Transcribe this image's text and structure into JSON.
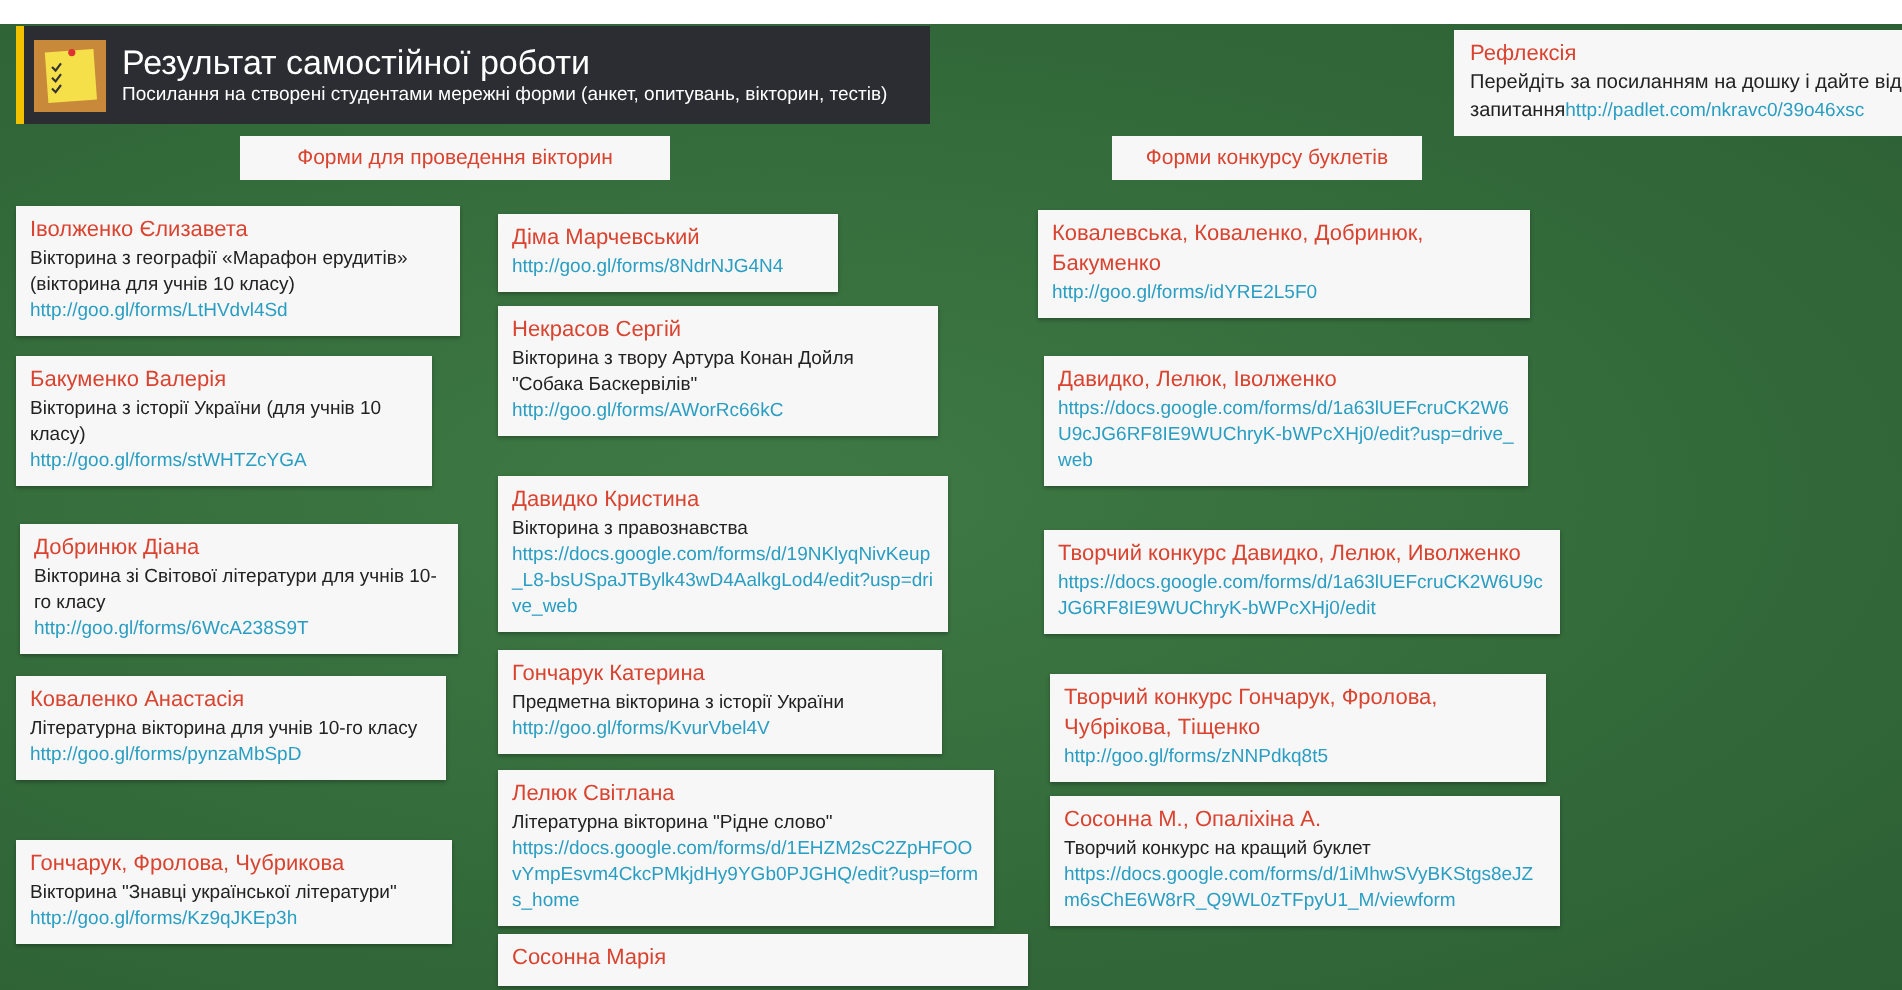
{
  "header": {
    "title": "Результат самостійної роботи",
    "subtitle": "Посилання на створені студентами мережні форми (анкет, опитувань, вікторин, тестів)"
  },
  "reflection": {
    "title": "Рефлексія",
    "lines": [
      "Перейдіть за посиланням на дошку і дайте від",
      "запитання"
    ],
    "link": "http://padlet.com/nkravc0/39o46xsc"
  },
  "sections": [
    {
      "title": "Форми для проведення вікторин"
    },
    {
      "title": "Форми конкурсу буклетів"
    }
  ],
  "columns": [
    {
      "cards": [
        {
          "name": "Іволженко Єлизавета",
          "text": "Вікторина з географії «Марафон ерудитів» (вікторина для учнів 10 класу)",
          "link": "http://goo.gl/forms/LtHVdvl4Sd"
        },
        {
          "name": "Бакуменко Валерія",
          "text": "Вікторина з історії України (для учнів 10 класу)",
          "link": "http://goo.gl/forms/stWHTZcYGA"
        },
        {
          "name": "Добринюк Діана",
          "text": "Вікторина зі Світової літератури для учнів 10-го класу",
          "link": "http://goo.gl/forms/6WcA238S9T"
        },
        {
          "name": "Коваленко Анастасія",
          "text": "Літературна вікторина  для учнів 10-го класу",
          "link": "http://goo.gl/forms/pynzaMbSpD"
        },
        {
          "name": "Гончарук, Фролова, Чубрикова",
          "text": "Вікторина \"Знавці української літератури\"",
          "link": "http://goo.gl/forms/Kz9qJKEp3h"
        }
      ]
    },
    {
      "cards": [
        {
          "name": "Діма Марчевський",
          "link": "http://goo.gl/forms/8NdrNJG4N4"
        },
        {
          "name": "Некрасов Сергій",
          "text": "Вікторина з твору Артура Конан Дойля \"Собака Баскервілів\"",
          "link": "http://goo.gl/forms/AWorRc66kC"
        },
        {
          "name": "Давидко Кристина",
          "text": "Вікторина з правознавства",
          "link": "https://docs.google.com/forms/d/19NKlyqNivKeup_L8-bsUSpaJTBylk43wD4AalkgLod4/edit?usp=drive_web"
        },
        {
          "name": "Гончарук Катерина",
          "text": "Предметна вікторина з історії України",
          "link": "http://goo.gl/forms/KvurVbel4V"
        },
        {
          "name": "Лелюк Світлана",
          "text": "Літературна вікторина \"Рідне слово\"",
          "link": "https://docs.google.com/forms/d/1EHZM2sC2ZpHFOOvYmpEsvm4CkcPMkjdHy9YGb0PJGHQ/edit?usp=forms_home"
        },
        {
          "name": "Сосонна Марія"
        }
      ]
    },
    {
      "cards": [
        {
          "name": "Ковалевська, Коваленко, Добринюк, Бакуменко",
          "link": "http://goo.gl/forms/idYRE2L5F0"
        },
        {
          "name": "Давидко, Лелюк, Іволженко",
          "link": "https://docs.google.com/forms/d/1a63lUEFcruCK2W6U9cJG6RF8IE9WUChryK-bWPcXHj0/edit?usp=drive_web"
        },
        {
          "name": "Творчий конкурс Давидко, Лелюк, Иволженко",
          "link": "https://docs.google.com/forms/d/1a63lUEFcruCK2W6U9cJG6RF8IE9WUChryK-bWPcXHj0/edit"
        },
        {
          "name": "Творчий конкурс Гончарук, Фролова, Чубрікова, Тіщенко",
          "link": "http://goo.gl/forms/zNNPdkq8t5"
        },
        {
          "name": "Сосонна М., Опаліхіна А.",
          "text": "Творчий конкурс на кращий буклет",
          "link": "https://docs.google.com/forms/d/1iMhwSVyBKStgs8eJZm6sChE6W8rR_Q9WL0zTFpyU1_M/viewform"
        }
      ]
    }
  ]
}
